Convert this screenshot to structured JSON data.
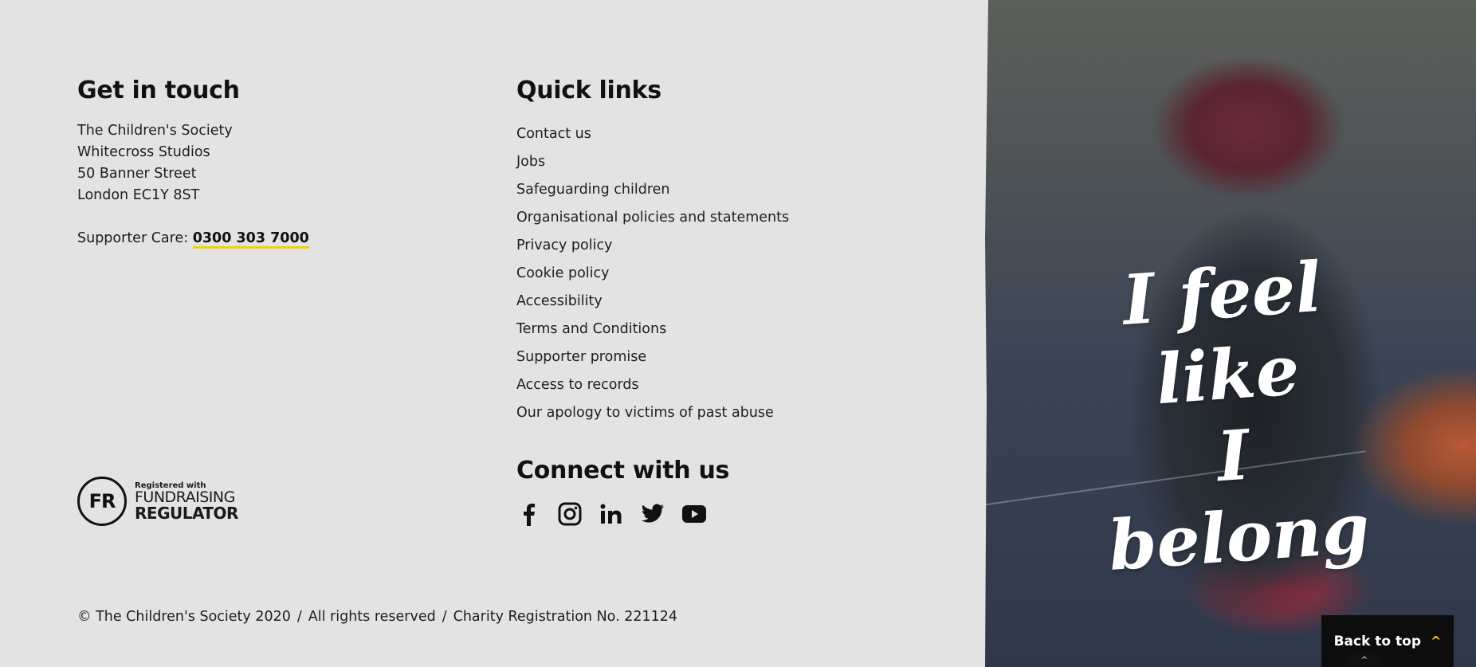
{
  "get_in_touch": {
    "heading": "Get in touch",
    "address": [
      "The Children's Society",
      "Whitecross Studios",
      "50 Banner Street",
      "London EC1Y 8ST"
    ],
    "supporter_label": "Supporter Care:",
    "phone": "0300 303 7000"
  },
  "quick_links": {
    "heading": "Quick links",
    "items": [
      "Contact us",
      "Jobs",
      "Safeguarding children",
      "Organisational policies and statements",
      "Privacy policy",
      "Cookie policy",
      "Accessibility",
      "Terms and Conditions",
      "Supporter promise",
      "Access to records",
      "Our apology to victims of past abuse"
    ]
  },
  "connect": {
    "heading": "Connect with us",
    "icons": [
      "facebook-icon",
      "instagram-icon",
      "linkedin-icon",
      "twitter-icon",
      "youtube-icon"
    ]
  },
  "regulator": {
    "badge": "FR",
    "line1": "Registered with",
    "line2": "FUNDRAISING",
    "line3": "REGULATOR"
  },
  "legal": {
    "copyright": "© The Children's Society 2020",
    "rights": "All rights reserved",
    "charity": "Charity Registration No. 221124",
    "separator": "/"
  },
  "hero": {
    "line1": "I feel like",
    "line2": "I belong"
  },
  "back_to_top": {
    "label": "Back to top",
    "chevron": "^"
  },
  "colors": {
    "background": "#e3e3e3",
    "accent_yellow": "#f2d200",
    "dark": "#0d0d0d"
  }
}
